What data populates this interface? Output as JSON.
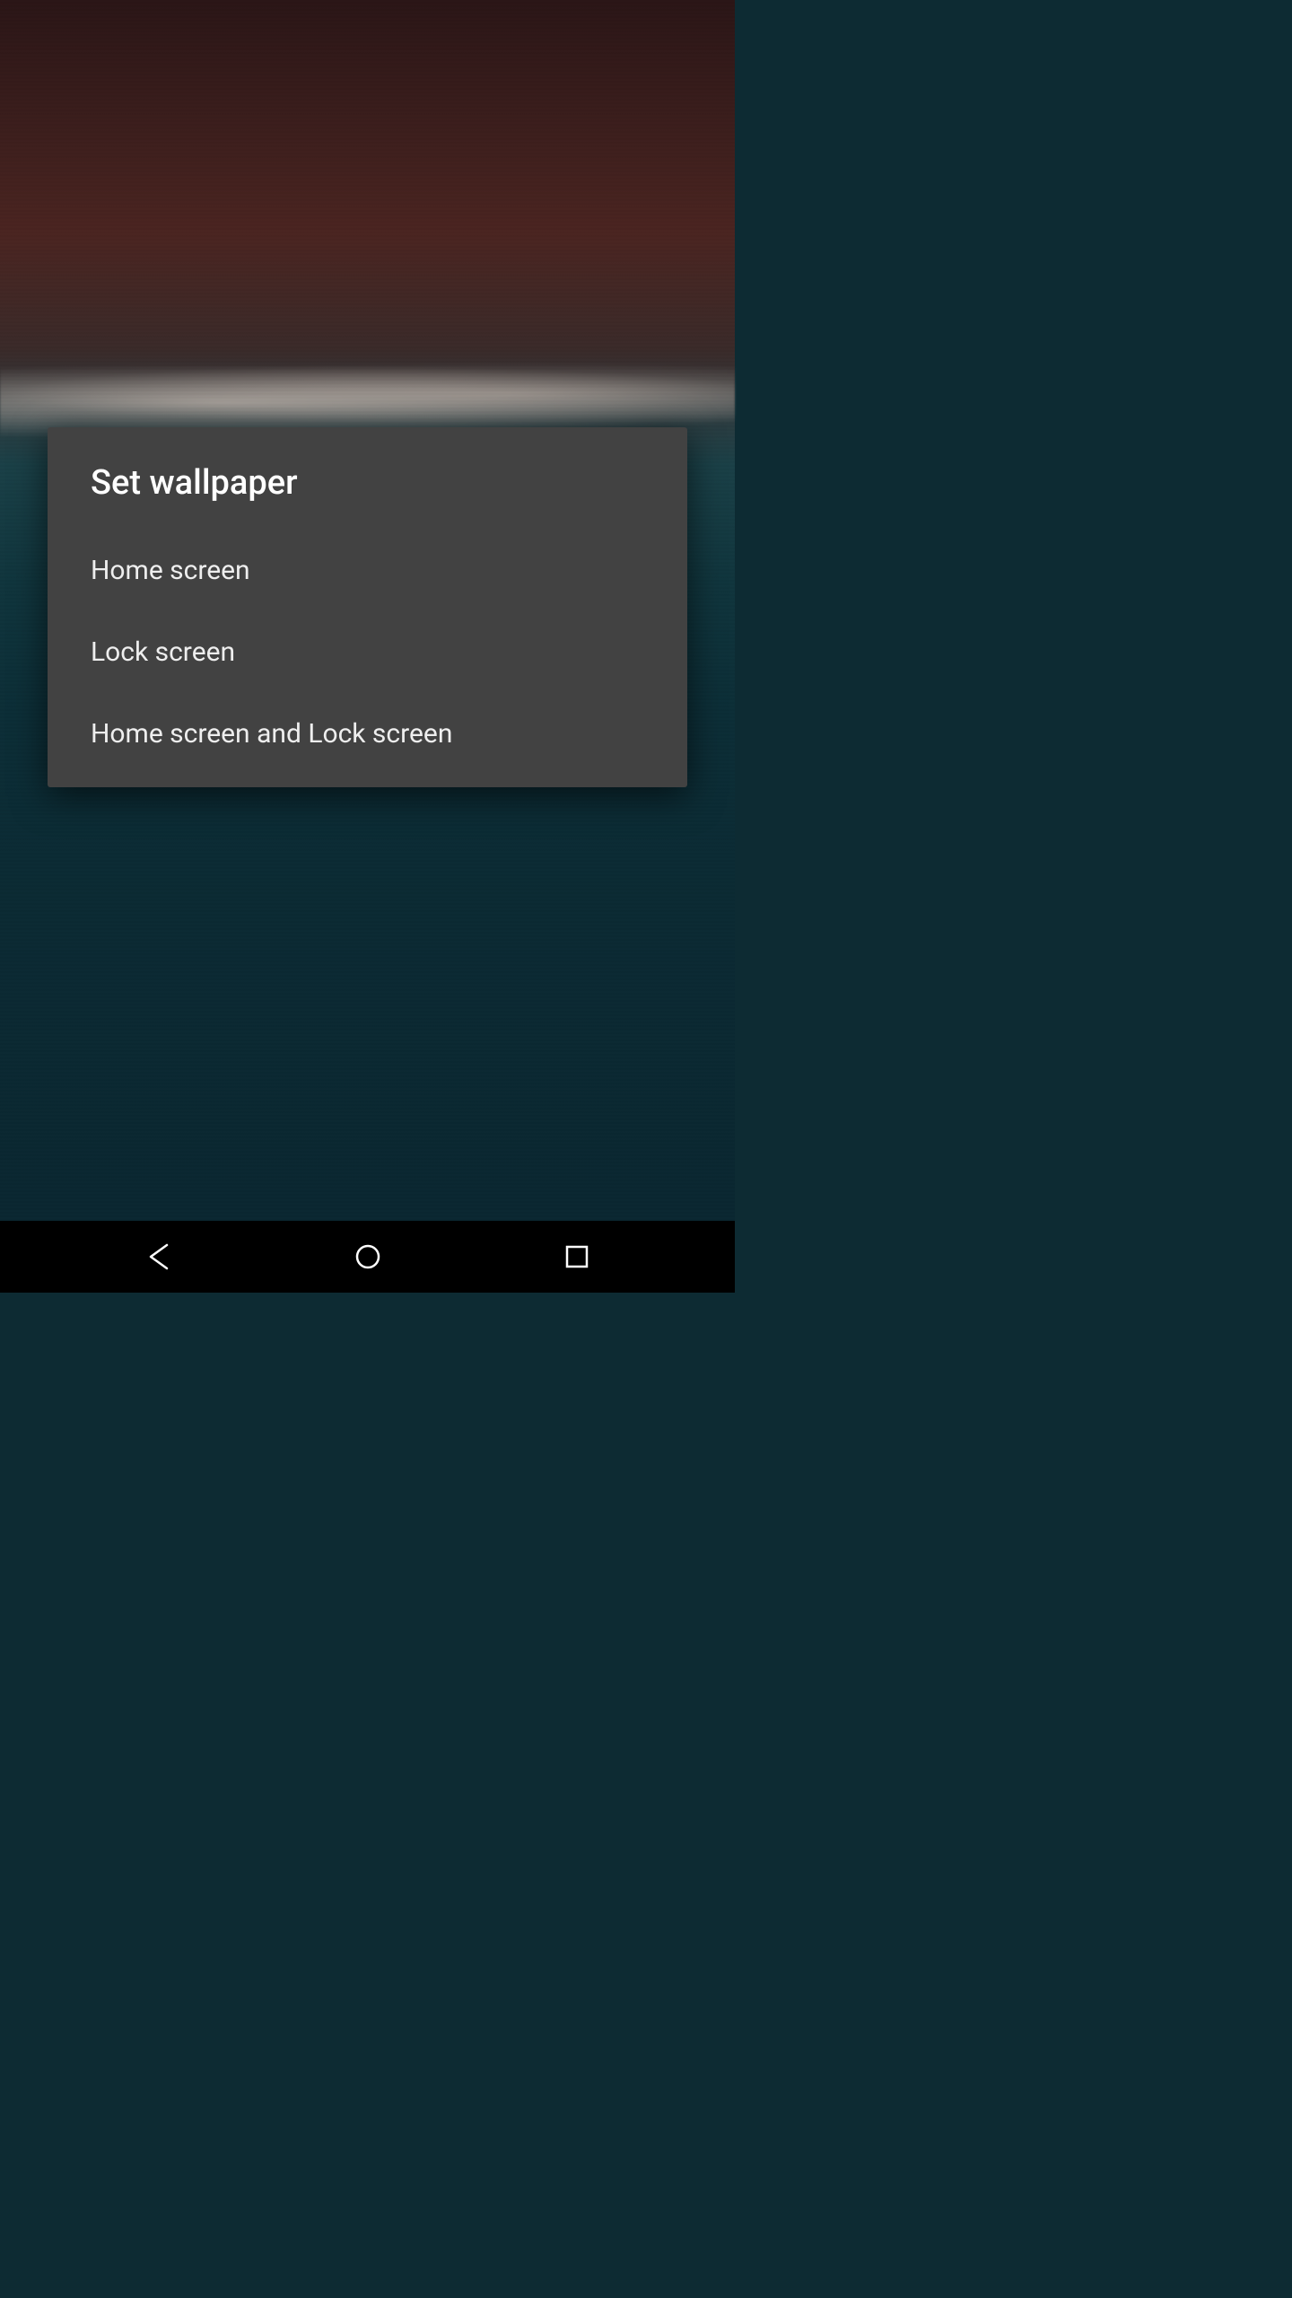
{
  "dialog": {
    "title": "Set wallpaper",
    "options": [
      {
        "label": "Home screen"
      },
      {
        "label": "Lock screen"
      },
      {
        "label": "Home screen and Lock screen"
      }
    ]
  },
  "colors": {
    "dialog_bg": "#424242",
    "text": "#ffffff"
  }
}
